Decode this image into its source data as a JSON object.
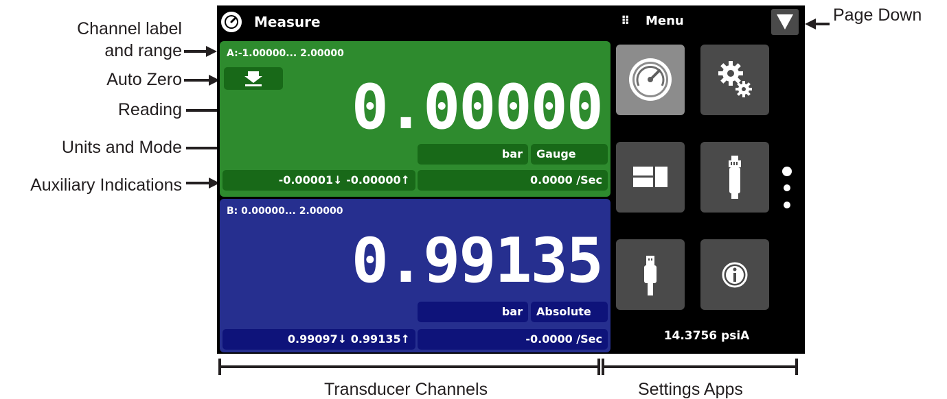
{
  "annotations": {
    "channel_label_line1": "Channel label",
    "channel_label_line2": "and range",
    "auto_zero": "Auto Zero",
    "reading": "Reading",
    "units_mode": "Units and Mode",
    "auxiliary": "Auxiliary Indications",
    "page_down": "Page Down",
    "transducer_channels": "Transducer Channels",
    "settings_apps": "Settings Apps"
  },
  "header": {
    "title": "Measure",
    "title_icon": "gauge-icon",
    "menu_icon": "grid-dots-icon",
    "menu_label": "Menu",
    "page_down_icon": "triangle-down-icon"
  },
  "channel_a": {
    "range": "A:-1.00000... 2.00000",
    "reading": "0.00000",
    "units": "bar",
    "mode": "Gauge",
    "aux_minmax": "-0.00001↓ -0.00000↑",
    "rate": "0.0000 /Sec",
    "color": "#2e8b2e"
  },
  "channel_b": {
    "range": "B: 0.00000... 2.00000",
    "reading": "0.99135",
    "units": "bar",
    "mode": "Absolute",
    "aux_minmax": "0.99097↓  0.99135↑",
    "rate": "-0.0000 /Sec",
    "color": "#262f8f"
  },
  "apps": [
    {
      "name": "measure-app",
      "icon": "gauge-icon",
      "active": true
    },
    {
      "name": "settings-app",
      "icon": "gears-icon",
      "active": false
    },
    {
      "name": "display-app",
      "icon": "window-layout-icon",
      "active": false
    },
    {
      "name": "sensor-app",
      "icon": "transducer-icon",
      "active": false
    },
    {
      "name": "usb-app",
      "icon": "usb-plug-icon",
      "active": false
    },
    {
      "name": "info-app",
      "icon": "info-icon",
      "active": false
    }
  ],
  "barometer": "14.3756 psiA"
}
